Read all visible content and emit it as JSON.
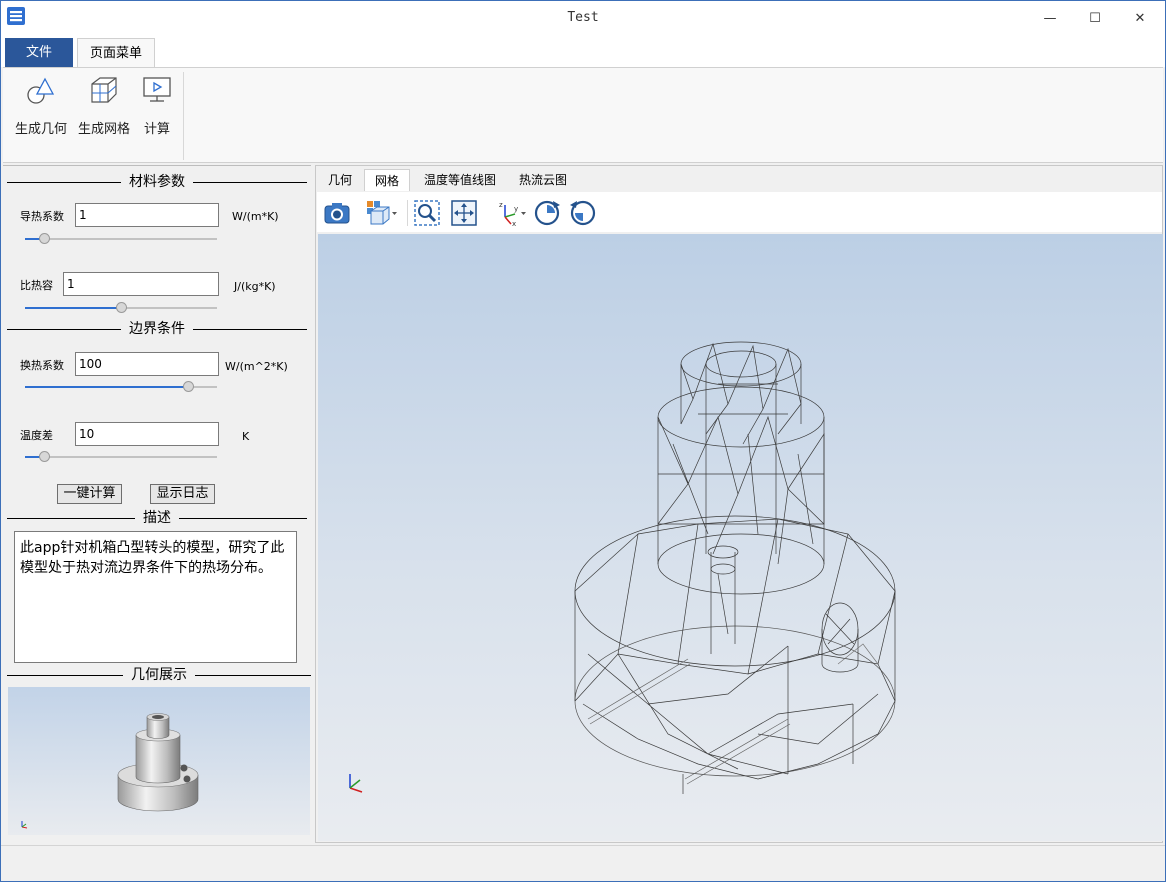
{
  "window": {
    "title": "Test",
    "minimize": "—",
    "maximize": "☐",
    "close": "✕"
  },
  "menu": {
    "file": "文件",
    "page_menu": "页面菜单"
  },
  "ribbon": {
    "gen_geometry": "生成几何",
    "gen_mesh": "生成网格",
    "compute": "计算"
  },
  "left": {
    "material_title": "材料参数",
    "conductivity": {
      "label": "导热系数",
      "value": "1",
      "unit": "W/(m*K)",
      "slider": 0.1
    },
    "heat_capacity": {
      "label": "比热容",
      "value": "1",
      "unit": "J/(kg*K)",
      "slider": 0.5
    },
    "boundary_title": "边界条件",
    "htc": {
      "label": "换热系数",
      "value": "100",
      "unit": "W/(m^2*K)",
      "slider": 0.85
    },
    "temp_diff": {
      "label": "温度差",
      "value": "10",
      "unit": "K",
      "slider": 0.1
    },
    "one_click": "一键计算",
    "show_log": "显示日志",
    "desc_title": "描述",
    "description": "此app针对机箱凸型转头的模型，研究了此模型处于热对流边界条件下的热场分布。",
    "geometry_title": "几何展示"
  },
  "viewer": {
    "tabs": [
      "几何",
      "网格",
      "温度等值线图",
      "热流云图"
    ],
    "active_tab": 1,
    "toolbar_icons": [
      "camera-icon",
      "view-cube-icon",
      "zoom-box-icon",
      "fit-view-icon",
      "axes-icon",
      "rotate-cw-icon",
      "rotate-ccw-icon"
    ]
  },
  "colors": {
    "accent": "#2b579a",
    "slider": "#2f6fd0"
  }
}
